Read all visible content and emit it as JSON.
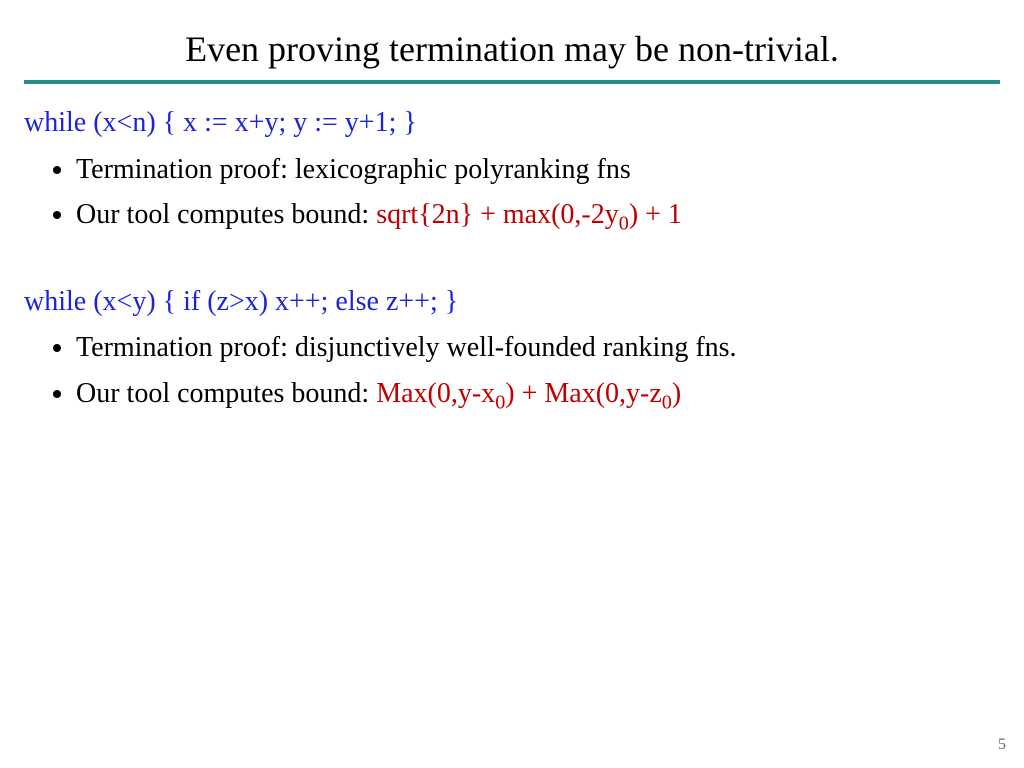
{
  "title": "Even proving termination may be non-trivial.",
  "block1": {
    "code": "while (x<n) { x := x+y; y := y+1; }",
    "bullet1": "Termination proof: lexicographic polyranking fns",
    "bullet2_prefix": "Our tool computes bound: ",
    "bullet2_red_a": "sqrt{2n} + max(0,-2y",
    "bullet2_red_sub": "0",
    "bullet2_red_b": ") + 1"
  },
  "block2": {
    "code": "while (x<y) { if (z>x) x++;  else z++; }",
    "bullet1": "Termination proof: disjunctively well-founded ranking fns.",
    "bullet2_prefix": "Our tool computes bound: ",
    "bullet2_red_a": "Max(0,y-x",
    "bullet2_red_sub1": "0",
    "bullet2_red_b": ") + Max(0,y-z",
    "bullet2_red_sub2": "0",
    "bullet2_red_c": ")"
  },
  "page_number": "5"
}
